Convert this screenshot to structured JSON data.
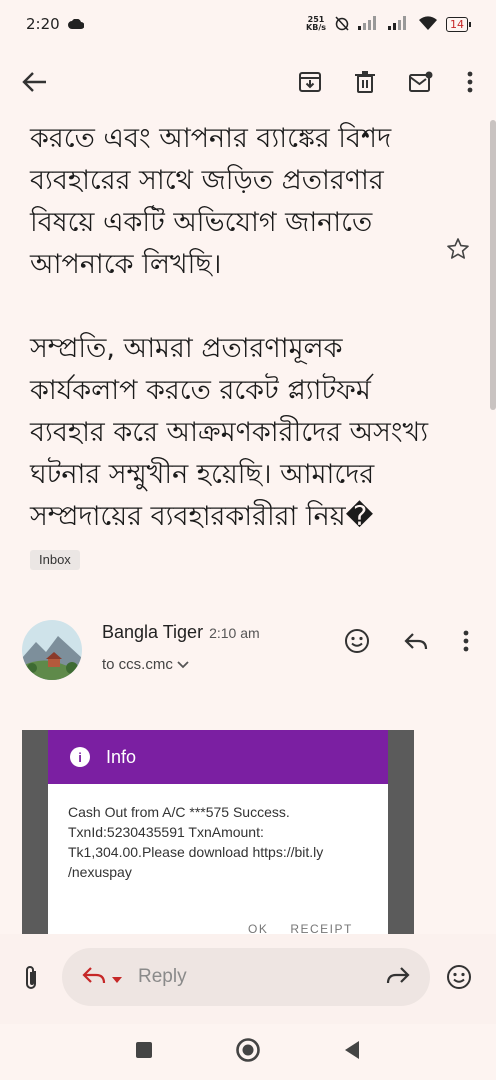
{
  "status": {
    "time": "2:20",
    "net_speed_value": "251",
    "net_speed_unit": "KB/s",
    "battery": "14"
  },
  "app_bar": {
    "back_icon": "arrow-back-icon",
    "archive_icon": "archive-icon",
    "delete_icon": "delete-icon",
    "mark_unread_icon": "mark-unread-icon",
    "more_icon": "more-vert-icon"
  },
  "message": {
    "paragraph1": "করতে এবং আপনার ব্যাঙ্কের বিশদ ব্যবহারের সাথে জড়িত প্রতারণার বিষয়ে একটি অভিযোগ জানাতে আপনাকে লিখছি।",
    "paragraph2": "সম্প্রতি, আমরা প্রতারণামূলক কার্যকলাপ করতে রকেট প্ল্যাটফর্ম ব্যবহার করে আক্রমণকারীদের অসংখ্য ঘটনার সম্মুখীন হয়েছি। আমাদের সম্প্রদায়ের ব্যবহারকারীরা নিয়�",
    "label_chip": "Inbox"
  },
  "sender": {
    "name": "Bangla Tiger",
    "time": "2:10 am",
    "recipient": "to ccs.cmc"
  },
  "attachment": {
    "dialog_title": "Info",
    "dialog_line1": "Cash Out from A/C ***575 Success.",
    "dialog_line2": "TxnId:5230435591 TxnAmount:",
    "dialog_line3": "Tk1,304.00.Please download https://bit.ly",
    "dialog_line4": "/nexuspay",
    "button_ok": "OK",
    "button_receipt": "RECEIPT"
  },
  "reply_bar": {
    "reply_label": "Reply"
  },
  "colors": {
    "background": "#fdf4f1",
    "dialog_header": "#7b1fa2",
    "battery_low": "#c62828"
  }
}
